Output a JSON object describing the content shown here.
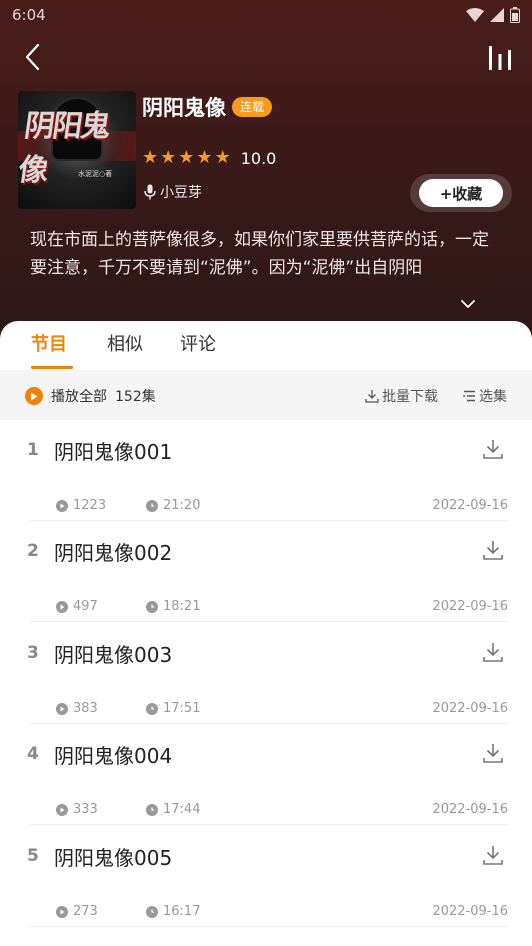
{
  "status_bar": {
    "time": "6:04"
  },
  "book": {
    "cover_title": "阴阳鬼像",
    "cover_author": "水泥泥○著",
    "title": "阴阳鬼像",
    "badge": "连载",
    "rating": "10.0",
    "stars": 5,
    "author": "小豆芽",
    "collect_label": "+收藏",
    "description": "现在市面上的菩萨像很多，如果你们家里要供菩萨的话，一定要注意，千万不要请到“泥佛”。因为“泥佛”出自阴阳"
  },
  "tabs": [
    {
      "label": "节目",
      "active": true
    },
    {
      "label": "相似",
      "active": false
    },
    {
      "label": "评论",
      "active": false
    }
  ],
  "toolbar": {
    "play_all": "播放全部",
    "count": "152集",
    "batch_download": "批量下载",
    "select": "选集"
  },
  "episodes": [
    {
      "num": "1",
      "title": "阴阳鬼像001",
      "plays": "1223",
      "duration": "21:20",
      "date": "2022-09-16"
    },
    {
      "num": "2",
      "title": "阴阳鬼像002",
      "plays": "497",
      "duration": "18:21",
      "date": "2022-09-16"
    },
    {
      "num": "3",
      "title": "阴阳鬼像003",
      "plays": "383",
      "duration": "17:51",
      "date": "2022-09-16"
    },
    {
      "num": "4",
      "title": "阴阳鬼像004",
      "plays": "333",
      "duration": "17:44",
      "date": "2022-09-16"
    },
    {
      "num": "5",
      "title": "阴阳鬼像005",
      "plays": "273",
      "duration": "16:17",
      "date": "2022-09-16"
    }
  ],
  "colors": {
    "accent": "#f0830b",
    "badge": "#f59a1b",
    "header": "#3c1a1a"
  }
}
